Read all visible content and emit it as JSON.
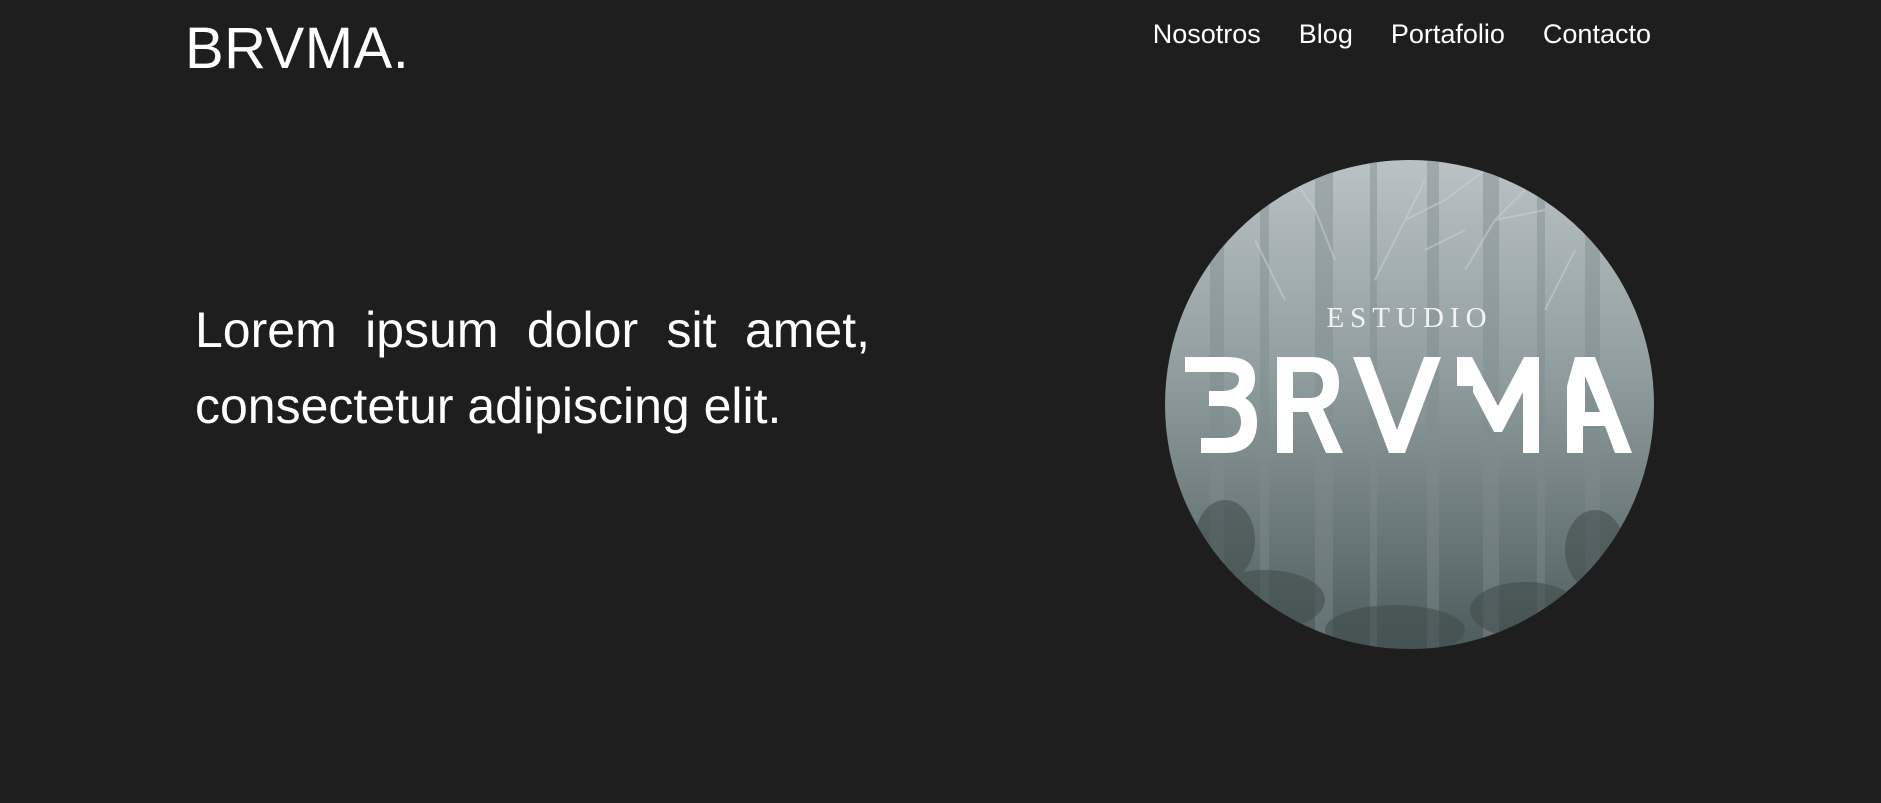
{
  "header": {
    "logo_text": "BRVMA.",
    "nav": [
      {
        "label": "Nosotros"
      },
      {
        "label": "Blog"
      },
      {
        "label": "Portafolio"
      },
      {
        "label": "Contacto"
      }
    ]
  },
  "hero": {
    "text": "Lorem ipsum dolor sit amet, consectetur adipiscing elit.",
    "image": {
      "subtitle": "ESTUDIO",
      "wordmark": "BRVMA"
    }
  },
  "colors": {
    "background": "#1e1e1e",
    "text": "#ffffff",
    "image_top": "#b9c2c4",
    "image_bottom": "#4c5c5c"
  }
}
